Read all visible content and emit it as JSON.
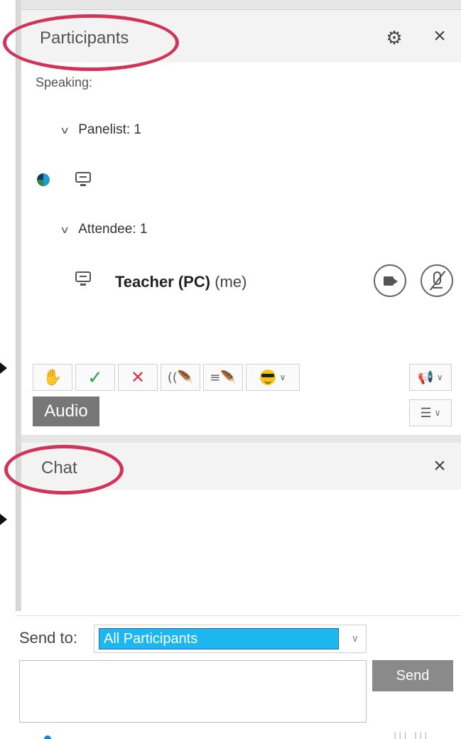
{
  "participants": {
    "title": "Participants",
    "settings_icon": "gear-icon",
    "close_icon": "close-icon",
    "speaking_label": "Speaking:",
    "groups": [
      {
        "label": "Panelist: 1"
      },
      {
        "label": "Attendee: 1"
      }
    ],
    "attendee": {
      "name": "Teacher (PC)",
      "suffix": "(me)"
    },
    "toolbar": {
      "audio_label": "Audio"
    }
  },
  "chat": {
    "title": "Chat",
    "close_icon": "close-icon",
    "send_to_label": "Send to:",
    "send_to_value": "All Participants",
    "send_button": "Send"
  },
  "annotations": {
    "highlight_color": "#d0345a"
  },
  "colors": {
    "selected_recipient_bg": "#1cb7ee",
    "audio_button_bg": "#777777",
    "send_button_bg": "#8a8a8a"
  }
}
